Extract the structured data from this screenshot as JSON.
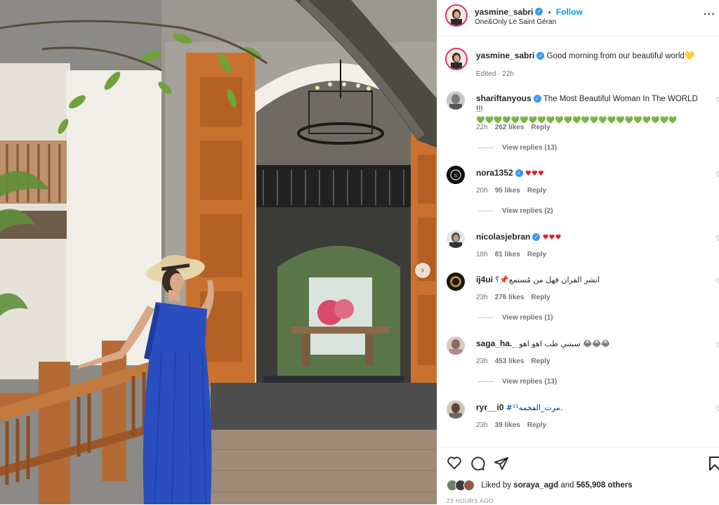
{
  "header": {
    "username": "yasmine_sabri",
    "follow_label": "Follow",
    "location": "One&Only Le Saint Géran",
    "separator": "•",
    "more": "•••"
  },
  "caption": {
    "username": "yasmine_sabri",
    "text": "Good morning from our beautiful world",
    "emoji": "💛",
    "edited": "Edited · 22h"
  },
  "comments": [
    {
      "username": "shariftanyous",
      "verified": true,
      "text": "The Most Beautiful Woman In The WORLD !!!",
      "emoji": "💚💚💚💚💚💚💚💚💚💚💚💚💚💚💚💚💚💚💚💚💚💚💚",
      "time": "22h",
      "likes": "262 likes",
      "reply": "Reply",
      "view_replies": "View replies (13)"
    },
    {
      "username": "nora1352",
      "verified": true,
      "text": "",
      "emoji": "♥♥♥",
      "time": "20h",
      "likes": "95 likes",
      "reply": "Reply",
      "view_replies": "View replies (2)"
    },
    {
      "username": "nicolasjebran",
      "verified": true,
      "text": "",
      "emoji": "♥♥♥",
      "time": "18h",
      "likes": "81 likes",
      "reply": "Reply",
      "view_replies": ""
    },
    {
      "username": "ij4ui",
      "verified": false,
      "text": "انشر القران فهل من مُستمع📌؟",
      "emoji": "",
      "time": "23h",
      "likes": "276 likes",
      "reply": "Reply",
      "view_replies": "View replies (1)"
    },
    {
      "username": "saga_ha._",
      "verified": false,
      "text": "سبتني طب اهو اهو 😂😂😂",
      "emoji": "",
      "time": "23h",
      "likes": "453 likes",
      "reply": "Reply",
      "view_replies": "View replies (13)"
    },
    {
      "username": "ryr__i0",
      "verified": false,
      "text": "#مرت_الفخمه¹¹.",
      "emoji": "",
      "time": "23h",
      "likes": "39 likes",
      "reply": "Reply",
      "view_replies": ""
    }
  ],
  "footer": {
    "liked_by_prefix": "Liked by",
    "liked_by_user": "soraya_agd",
    "and": "and",
    "others": "565,908 others",
    "posted": "23 HOURS AGO"
  },
  "icons": {
    "heart": "heart-icon",
    "comment": "comment-icon",
    "share": "share-icon",
    "save": "bookmark-icon",
    "next": "chevron-right-icon",
    "verified": "verified-badge-icon"
  },
  "colors": {
    "accent": "#0095f6",
    "verified": "#3897f0",
    "dress": "#2a4ec0",
    "door": "#c9722f"
  }
}
